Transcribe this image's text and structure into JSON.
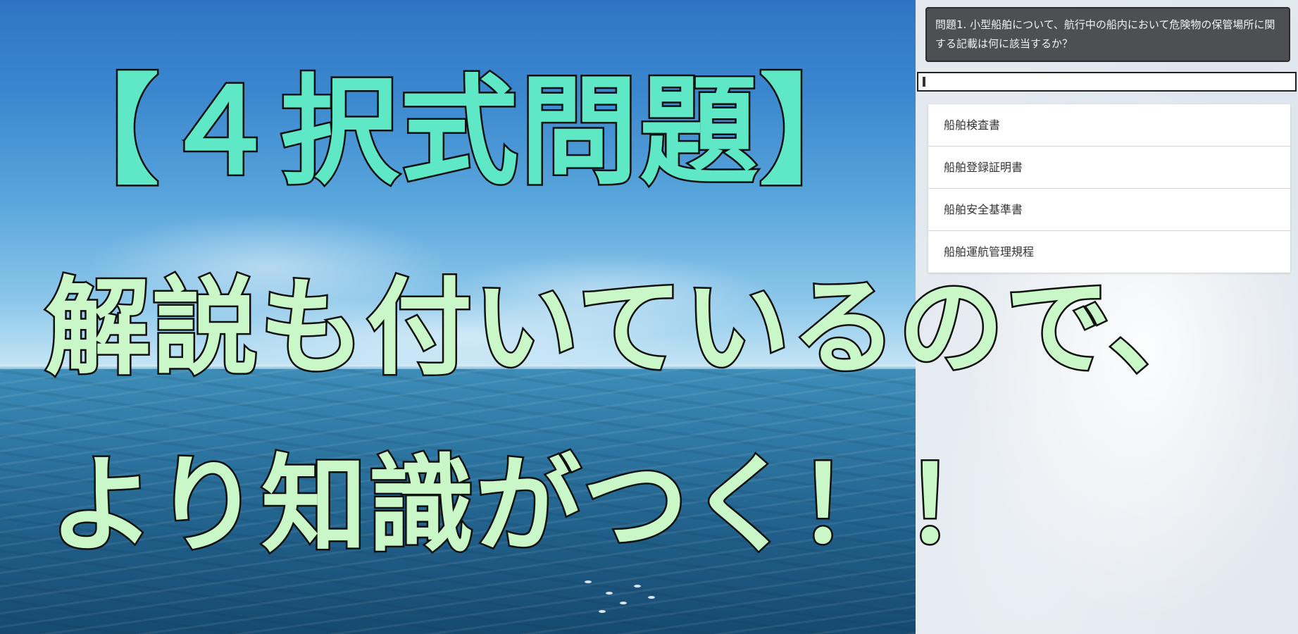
{
  "headlines": {
    "line1": "【４択式問題】",
    "line2": "解説も付いているので、",
    "line3": "より知識がつく！！"
  },
  "quiz": {
    "question": "問題1. 小型船舶について、航行中の船内において危険物の保管場所に関する記載は何に該当するか？",
    "answer_value": "",
    "choices": [
      "船舶検査書",
      "船舶登録証明書",
      "船舶安全基準書",
      "船舶運航管理規程"
    ]
  },
  "colors": {
    "headline_primary": "#5fe8c6",
    "headline_secondary": "#c9f7c8",
    "question_bg": "#4d4f52"
  }
}
